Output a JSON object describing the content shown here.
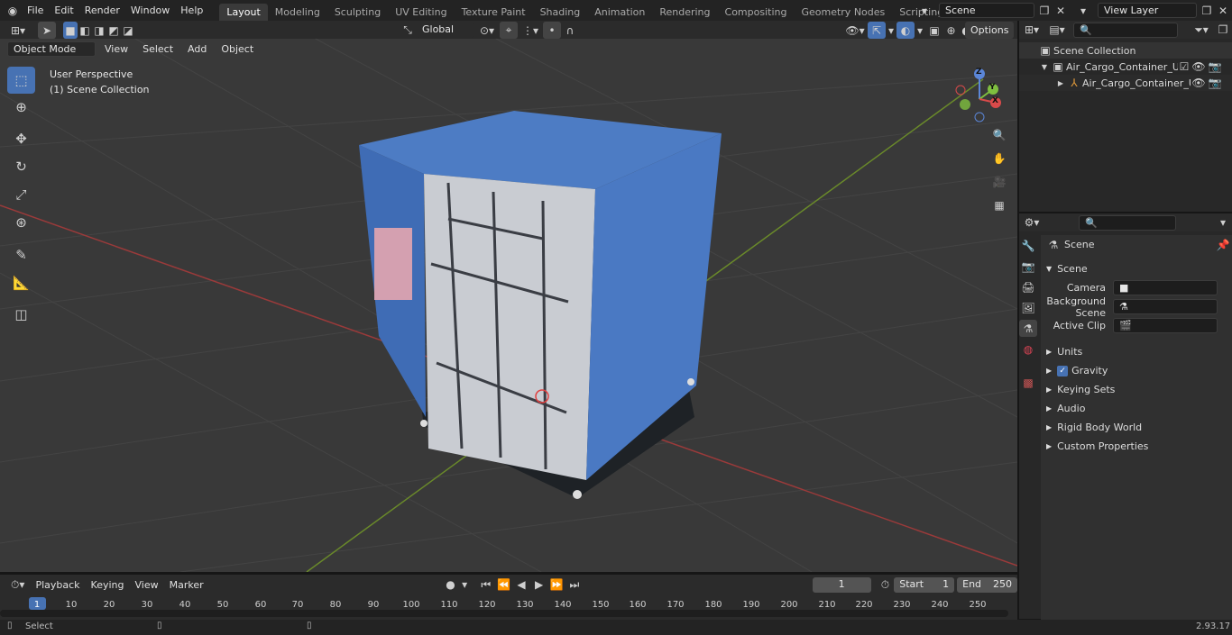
{
  "topbar": {
    "menus": [
      "File",
      "Edit",
      "Render",
      "Window",
      "Help"
    ],
    "workspaces": [
      "Layout",
      "Modeling",
      "Sculpting",
      "UV Editing",
      "Texture Paint",
      "Shading",
      "Animation",
      "Rendering",
      "Compositing",
      "Geometry Nodes",
      "Scripting"
    ],
    "add_tab": "+",
    "scene": "Scene",
    "view_layer": "View Layer"
  },
  "viewport_header": {
    "mode": "Object Mode",
    "menus": [
      "View",
      "Select",
      "Add",
      "Object"
    ],
    "orientation": "Global",
    "options": "Options"
  },
  "viewport": {
    "perspective": "User Perspective",
    "collection": "(1) Scene Collection",
    "gizmo": {
      "z": "Z",
      "y": "Y",
      "x": "X"
    }
  },
  "outliner": {
    "root": "Scene Collection",
    "items": [
      "Air_Cargo_Container_ULD_LD",
      "Air_Cargo_Container_ULI"
    ]
  },
  "properties": {
    "header": "Scene",
    "panel": "Scene",
    "fields": [
      {
        "label": "Camera"
      },
      {
        "label": "Background Scene"
      },
      {
        "label": "Active Clip"
      }
    ],
    "sections": [
      "Units",
      "Gravity",
      "Keying Sets",
      "Audio",
      "Rigid Body World",
      "Custom Properties"
    ],
    "gravity_checked": true
  },
  "timeline": {
    "menus": [
      "Playback",
      "Keying",
      "View",
      "Marker"
    ],
    "current_frame": "1",
    "start_label": "Start",
    "start": "1",
    "end_label": "End",
    "end": "250",
    "ticks": [
      "1",
      "10",
      "20",
      "30",
      "40",
      "50",
      "60",
      "70",
      "80",
      "90",
      "100",
      "110",
      "120",
      "130",
      "140",
      "150",
      "160",
      "170",
      "180",
      "190",
      "200",
      "210",
      "220",
      "230",
      "240",
      "250"
    ]
  },
  "status": {
    "left": "Select",
    "version": "2.93.17"
  }
}
